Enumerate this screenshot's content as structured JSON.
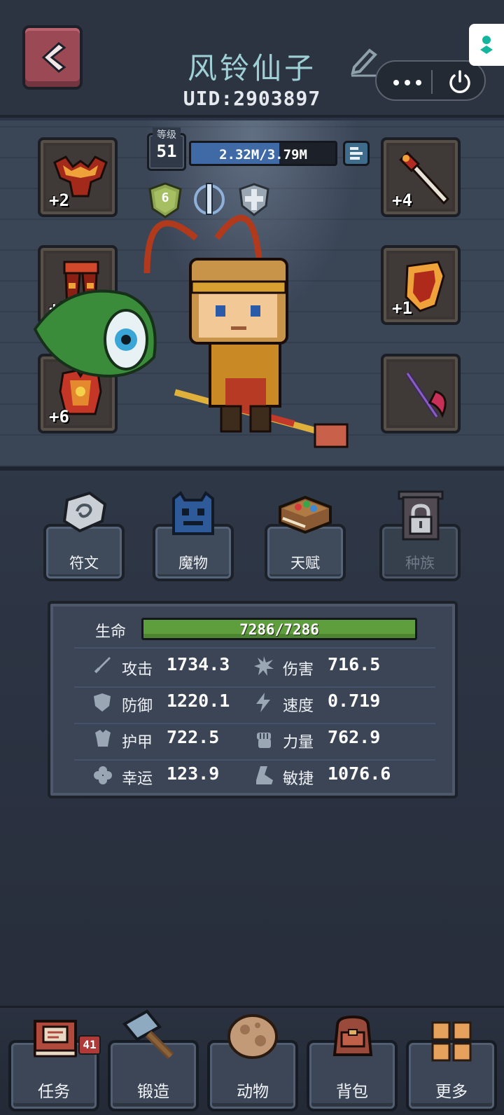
{
  "header": {
    "player_name": "风铃仙子",
    "uid": "UID:2903897"
  },
  "character": {
    "level_label": "等级",
    "level": "51",
    "exp_text": "2.32M/3.79M",
    "exp_fraction": 0.612,
    "rank_badge": "6",
    "slots": {
      "top_left": "+2",
      "mid_left": "+1",
      "bottom_left": "+6",
      "top_right": "+4",
      "mid_right": "+1",
      "bottom_right": ""
    }
  },
  "functions": [
    {
      "label": "符文",
      "icon": "rune-stone-icon",
      "locked": false
    },
    {
      "label": "魔物",
      "icon": "monster-icon",
      "locked": false
    },
    {
      "label": "天赋",
      "icon": "talent-book-icon",
      "locked": false
    },
    {
      "label": "种族",
      "icon": "lock-icon",
      "locked": true
    }
  ],
  "stats": {
    "hp_label": "生命",
    "hp_text": "7286/7286",
    "hp_fraction": 1.0,
    "attack": {
      "name": "攻击",
      "value": "1734.3",
      "icon": "sword-icon"
    },
    "damage": {
      "name": "伤害",
      "value": "716.5",
      "icon": "burst-icon"
    },
    "defense": {
      "name": "防御",
      "value": "1220.1",
      "icon": "shield-icon"
    },
    "speed": {
      "name": "速度",
      "value": "0.719",
      "icon": "lightning-icon"
    },
    "armor": {
      "name": "护甲",
      "value": "722.5",
      "icon": "armor-icon"
    },
    "strength": {
      "name": "力量",
      "value": "762.9",
      "icon": "fist-icon"
    },
    "luck": {
      "name": "幸运",
      "value": "123.9",
      "icon": "clover-icon"
    },
    "agility": {
      "name": "敏捷",
      "value": "1076.6",
      "icon": "boot-icon"
    }
  },
  "nav": {
    "tasks": "任务",
    "tasks_badge": "41",
    "forge": "锻造",
    "animals": "动物",
    "bag": "背包",
    "more": "更多"
  },
  "colors": {
    "back_button": "#9b4a55",
    "hp_fill": "#5f9e3d",
    "exp_fill": "#3f6aa6",
    "name_color": "#9fd0d6"
  }
}
